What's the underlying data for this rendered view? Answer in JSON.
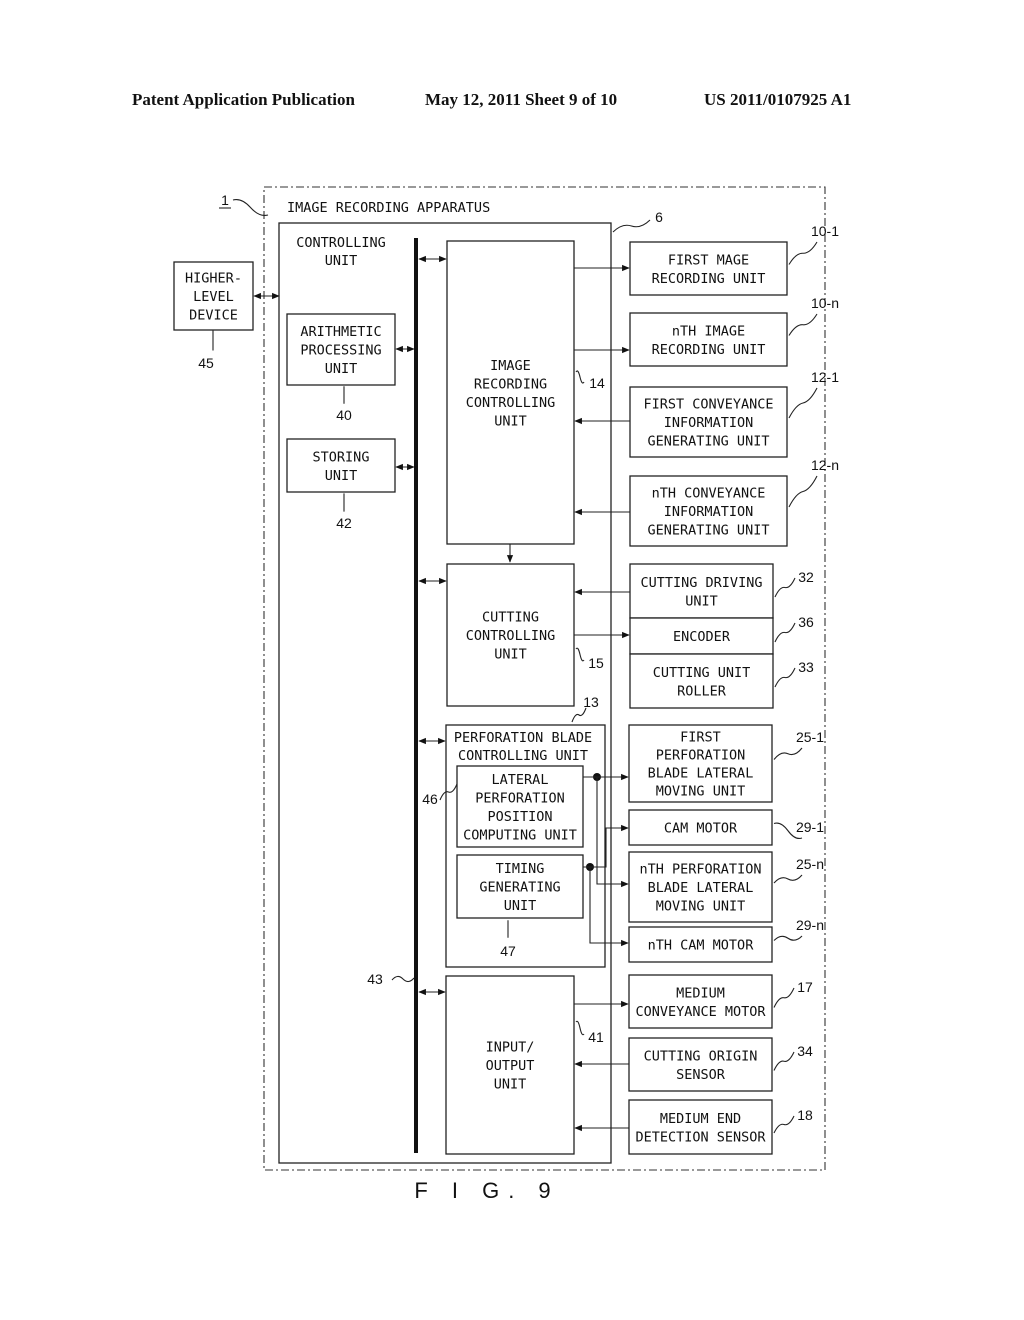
{
  "header": {
    "publication": "Patent Application Publication",
    "date_sheet": "May 12, 2011  Sheet 9 of 10",
    "patent_number": "US 2011/0107925 A1"
  },
  "figure": {
    "caption": "F I G. 9",
    "apparatus": {
      "label": "IMAGE RECORDING APPARATUS",
      "ref": "1"
    },
    "controlling_unit": {
      "lines": [
        "CONTROLLING",
        "UNIT"
      ],
      "ref": "6"
    },
    "bus_ref": "43",
    "higher_level_device": {
      "lines": [
        "HIGHER-",
        "LEVEL",
        "DEVICE"
      ],
      "ref": "45"
    },
    "arithmetic_processing_unit": {
      "lines": [
        "ARITHMETIC",
        "PROCESSING",
        "UNIT"
      ],
      "ref": "40"
    },
    "storing_unit": {
      "lines": [
        "STORING",
        "UNIT"
      ],
      "ref": "42"
    },
    "image_recording_controlling_unit": {
      "lines": [
        "IMAGE",
        "RECORDING",
        "CONTROLLING",
        "UNIT"
      ],
      "ref": "14"
    },
    "cutting_controlling_unit": {
      "lines": [
        "CUTTING",
        "CONTROLLING",
        "UNIT"
      ],
      "ref": "15"
    },
    "perforation_blade_controlling_unit": {
      "lines": [
        "PERFORATION BLADE",
        "CONTROLLING UNIT"
      ],
      "ref": "13"
    },
    "lateral_perforation_position_computing_unit": {
      "lines": [
        "LATERAL",
        "PERFORATION",
        "POSITION",
        "COMPUTING UNIT"
      ],
      "ref": "46"
    },
    "timing_generating_unit": {
      "lines": [
        "TIMING",
        "GENERATING",
        "UNIT"
      ],
      "ref": "47"
    },
    "input_output_unit": {
      "lines": [
        "INPUT/",
        "OUTPUT",
        "UNIT"
      ],
      "ref": "41"
    },
    "peripherals": [
      {
        "id": "first-image-recording-unit",
        "lines": [
          "FIRST MAGE",
          "RECORDING UNIT"
        ],
        "ref": "10-1"
      },
      {
        "id": "nth-image-recording-unit",
        "lines": [
          "nTH IMAGE",
          "RECORDING UNIT"
        ],
        "ref": "10-n"
      },
      {
        "id": "first-conveyance-information-generating-unit",
        "lines": [
          "FIRST CONVEYANCE",
          "INFORMATION",
          "GENERATING UNIT"
        ],
        "ref": "12-1"
      },
      {
        "id": "nth-conveyance-information-generating-unit",
        "lines": [
          "nTH CONVEYANCE",
          "INFORMATION",
          "GENERATING UNIT"
        ],
        "ref": "12-n"
      },
      {
        "id": "cutting-driving-unit",
        "lines": [
          "CUTTING DRIVING",
          "UNIT"
        ],
        "ref": "32"
      },
      {
        "id": "encoder",
        "lines": [
          "ENCODER"
        ],
        "ref": "36"
      },
      {
        "id": "cutting-unit-roller",
        "lines": [
          "CUTTING UNIT",
          "ROLLER"
        ],
        "ref": "33"
      },
      {
        "id": "first-perforation-blade-lateral-moving-unit",
        "lines": [
          "FIRST",
          "PERFORATION",
          "BLADE LATERAL",
          "MOVING UNIT"
        ],
        "ref": "25-1"
      },
      {
        "id": "cam-motor",
        "lines": [
          "CAM MOTOR"
        ],
        "ref": "29-1"
      },
      {
        "id": "nth-perforation-blade-lateral-moving-unit",
        "lines": [
          "nTH PERFORATION",
          "BLADE LATERAL",
          "MOVING UNIT"
        ],
        "ref": "25-n"
      },
      {
        "id": "nth-cam-motor",
        "lines": [
          "nTH CAM MOTOR"
        ],
        "ref": "29-n"
      },
      {
        "id": "medium-conveyance-motor",
        "lines": [
          "MEDIUM",
          "CONVEYANCE MOTOR"
        ],
        "ref": "17"
      },
      {
        "id": "cutting-origin-sensor",
        "lines": [
          "CUTTING ORIGIN",
          "SENSOR"
        ],
        "ref": "34"
      },
      {
        "id": "medium-end-detection-sensor",
        "lines": [
          "MEDIUM END",
          "DETECTION SENSOR"
        ],
        "ref": "18"
      }
    ]
  }
}
